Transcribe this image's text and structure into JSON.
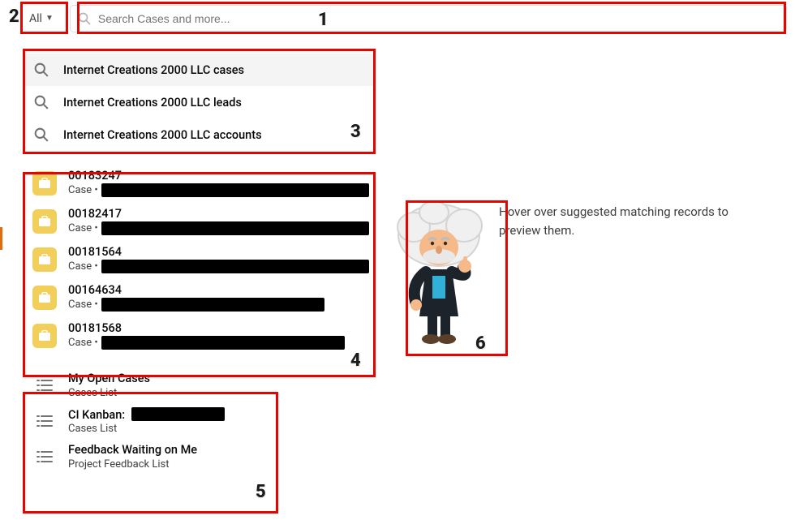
{
  "search": {
    "scope_label": "All",
    "placeholder": "Search Cases and more..."
  },
  "suggestions": [
    {
      "label": "Internet Creations 2000 LLC cases"
    },
    {
      "label": "Internet Creations 2000 LLC leads"
    },
    {
      "label": "Internet Creations 2000 LLC accounts"
    }
  ],
  "records": [
    {
      "number": "00183247",
      "type": "Case"
    },
    {
      "number": "00182417",
      "type": "Case"
    },
    {
      "number": "00181564",
      "type": "Case"
    },
    {
      "number": "00164634",
      "type": "Case"
    },
    {
      "number": "00181568",
      "type": "Case"
    }
  ],
  "lists": [
    {
      "title": "My Open Cases",
      "subtitle": "Cases List"
    },
    {
      "title": "CI Kanban:",
      "subtitle": "Cases List"
    },
    {
      "title": "Feedback Waiting on Me",
      "subtitle": "Project Feedback List"
    }
  ],
  "preview": {
    "hint": "Hover over suggested matching records to preview them."
  },
  "annotations": {
    "n1": "1",
    "n2": "2",
    "n3": "3",
    "n4": "4",
    "n5": "5",
    "n6": "6"
  }
}
